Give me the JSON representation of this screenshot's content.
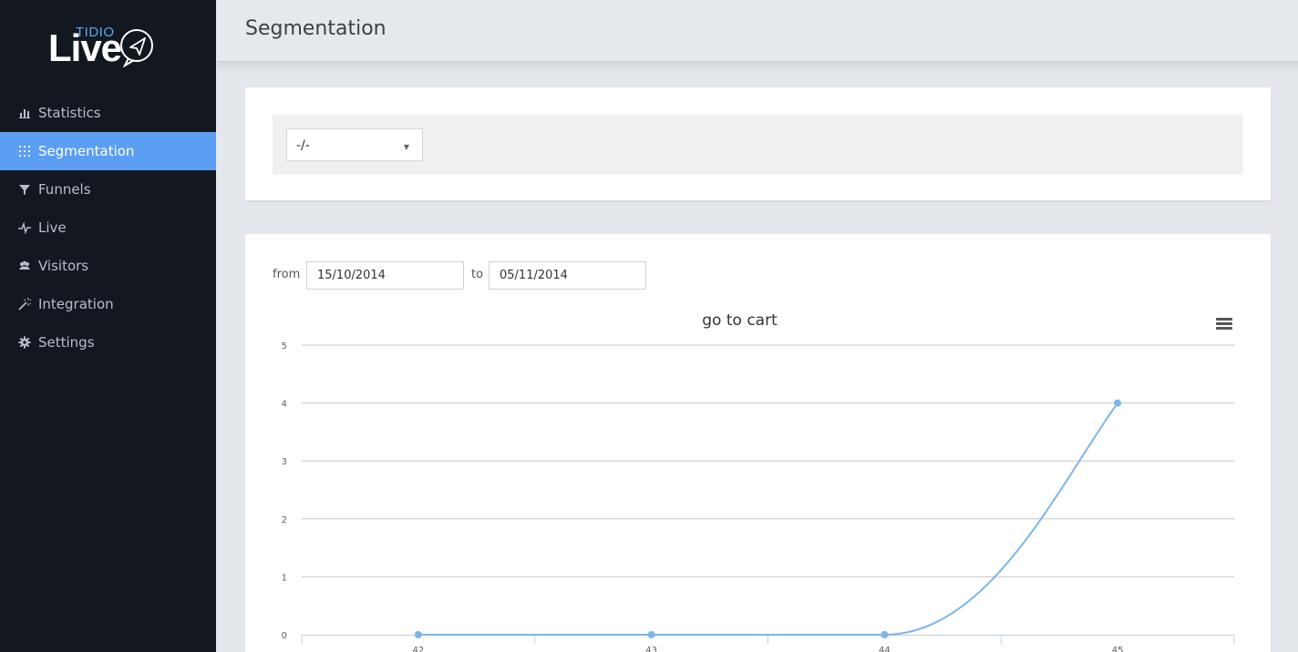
{
  "brand": {
    "tidio": "TIDIO",
    "live": "Live"
  },
  "nav": {
    "items": [
      {
        "label": "Statistics",
        "icon": "bar-chart-icon",
        "active": false
      },
      {
        "label": "Segmentation",
        "icon": "grid-icon",
        "active": true
      },
      {
        "label": "Funnels",
        "icon": "funnel-icon",
        "active": false
      },
      {
        "label": "Live",
        "icon": "pulse-icon",
        "active": false
      },
      {
        "label": "Visitors",
        "icon": "users-icon",
        "active": false
      },
      {
        "label": "Integration",
        "icon": "magic-wand-icon",
        "active": false
      },
      {
        "label": "Settings",
        "icon": "gear-icon",
        "active": false
      }
    ]
  },
  "header": {
    "title": "Segmentation"
  },
  "segment_select": {
    "value": "-/-"
  },
  "range": {
    "from_label": "from",
    "from_value": "15/10/2014",
    "to_label": "to",
    "to_value": "05/11/2014"
  },
  "colors": {
    "accent": "#5b9ef2",
    "sidebar": "#131820",
    "line": "#7cb5ec"
  },
  "chart_data": {
    "type": "line",
    "title": "go to cart",
    "xlabel": "",
    "ylabel": "",
    "x": [
      "42",
      "43",
      "44",
      "45"
    ],
    "series": [
      {
        "values": [
          0,
          0,
          0,
          4
        ]
      }
    ],
    "yticks": [
      0,
      1,
      2,
      3,
      4,
      5
    ],
    "ylim": [
      0,
      5
    ],
    "grid": true,
    "smooth": true
  }
}
